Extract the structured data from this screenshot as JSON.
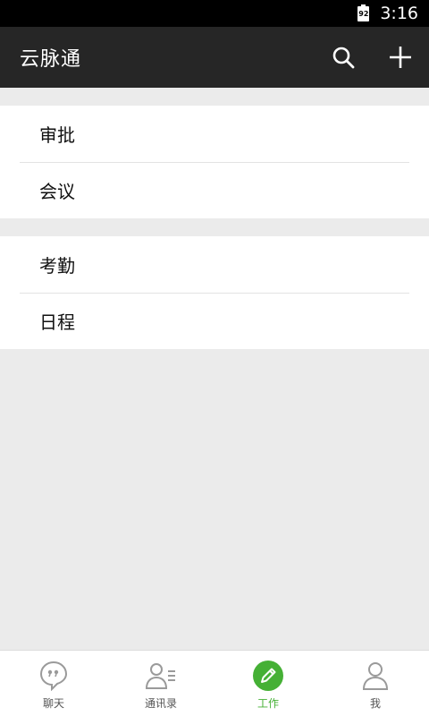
{
  "status_bar": {
    "battery_level": "92",
    "time": "3:16"
  },
  "app_bar": {
    "title": "云脉通"
  },
  "groups": [
    {
      "items": [
        {
          "label": "审批"
        },
        {
          "label": "会议"
        }
      ]
    },
    {
      "items": [
        {
          "label": "考勤"
        },
        {
          "label": "日程"
        }
      ]
    }
  ],
  "tab_bar": {
    "tabs": [
      {
        "label": "聊天",
        "icon": "chat-bubble-icon",
        "active": false
      },
      {
        "label": "通讯录",
        "icon": "contacts-icon",
        "active": false
      },
      {
        "label": "工作",
        "icon": "pencil-icon",
        "active": true
      },
      {
        "label": "我",
        "icon": "person-icon",
        "active": false
      }
    ]
  },
  "colors": {
    "app_bar": "#262626",
    "accent": "#45b035",
    "background": "#ebebeb"
  }
}
